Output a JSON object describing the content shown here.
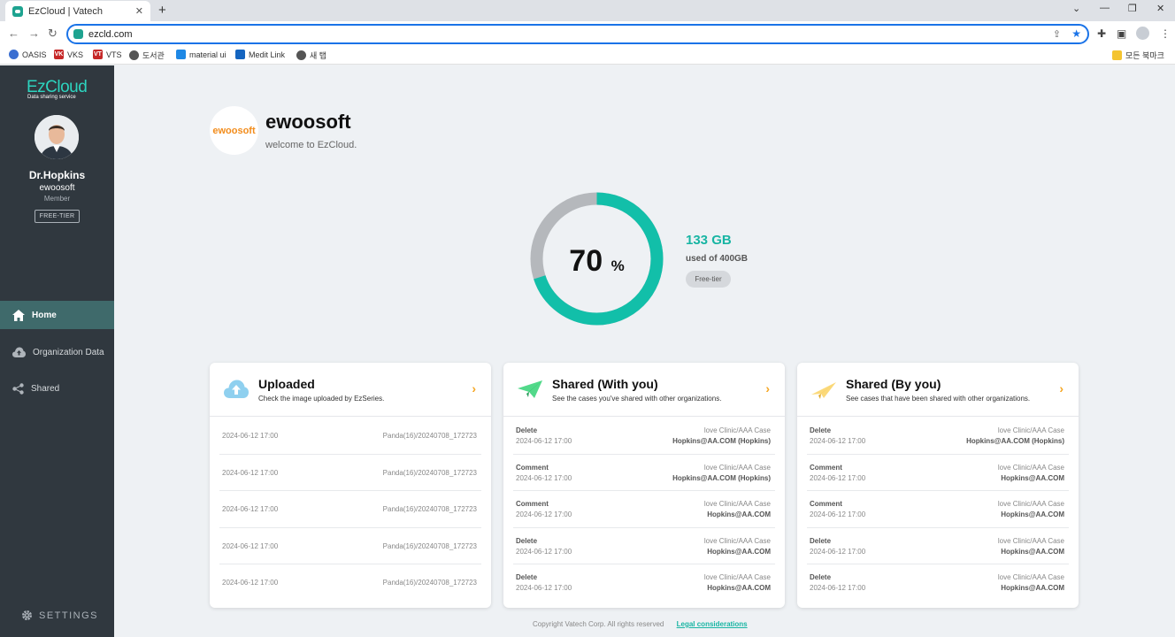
{
  "browser": {
    "tab_title": "EzCloud | Vatech",
    "url": "ezcld.com",
    "bookmarks": [
      {
        "label": "OASIS",
        "color": "#3b6fd1",
        "badge": ""
      },
      {
        "label": "VKS",
        "color": "#c62828",
        "badge": "VK"
      },
      {
        "label": "VTS",
        "color": "#c62828",
        "badge": "VT"
      },
      {
        "label": "도서관",
        "color": "#555555",
        "badge": ""
      },
      {
        "label": "material ui",
        "color": "#1e88e5",
        "badge": ""
      },
      {
        "label": "Medit Link",
        "color": "#1565c0",
        "badge": ""
      },
      {
        "label": "새 탭",
        "color": "#555555",
        "badge": ""
      }
    ],
    "all_bookmarks": "모든 북마크"
  },
  "sidebar": {
    "logo": "EzCloud",
    "logo_sub": "Data sharing service",
    "user_name": "Dr.Hopkins",
    "user_org": "ewoosoft",
    "user_role": "Member",
    "tier": "FREE-TIER",
    "nav": [
      {
        "label": "Home"
      },
      {
        "label": "Organization Data"
      },
      {
        "label": "Shared"
      }
    ],
    "settings": "SETTINGS"
  },
  "org": {
    "logo_text": "ewoosoft",
    "name": "ewoosoft",
    "welcome": "welcome to EzCloud."
  },
  "storage": {
    "percent": 70,
    "percent_label": "70",
    "percent_sym": "%",
    "used": "133 GB",
    "used_of": "used of 400GB",
    "tier_pill": "Free-tier",
    "colors": {
      "used": "#12bfa9",
      "remaining": "#b5b8bc"
    }
  },
  "cards": {
    "uploaded": {
      "title": "Uploaded",
      "subtitle": "Check the image uploaded by EzSeries.",
      "rows": [
        {
          "date": "2024-06-12 17:00",
          "file": "Panda(16)/20240708_172723"
        },
        {
          "date": "2024-06-12 17:00",
          "file": "Panda(16)/20240708_172723"
        },
        {
          "date": "2024-06-12 17:00",
          "file": "Panda(16)/20240708_172723"
        },
        {
          "date": "2024-06-12 17:00",
          "file": "Panda(16)/20240708_172723"
        },
        {
          "date": "2024-06-12 17:00",
          "file": "Panda(16)/20240708_172723"
        }
      ]
    },
    "shared_with": {
      "title": "Shared (With you)",
      "subtitle": "See the cases you've shared with other organizations.",
      "rows": [
        {
          "action": "Delete",
          "date": "2024-06-12 17:00",
          "case": "love Clinic/AAA Case",
          "who": "Hopkins@AA.COM (Hopkins)"
        },
        {
          "action": "Comment",
          "date": "2024-06-12 17:00",
          "case": "love Clinic/AAA Case",
          "who": "Hopkins@AA.COM (Hopkins)"
        },
        {
          "action": "Comment",
          "date": "2024-06-12 17:00",
          "case": "love Clinic/AAA Case",
          "who": "Hopkins@AA.COM"
        },
        {
          "action": "Delete",
          "date": "2024-06-12 17:00",
          "case": "love Clinic/AAA Case",
          "who": "Hopkins@AA.COM"
        },
        {
          "action": "Delete",
          "date": "2024-06-12 17:00",
          "case": "love Clinic/AAA Case",
          "who": "Hopkins@AA.COM"
        }
      ]
    },
    "shared_by": {
      "title": "Shared (By you)",
      "subtitle": "See cases that have been shared with other organizations.",
      "rows": [
        {
          "action": "Delete",
          "date": "2024-06-12 17:00",
          "case": "love Clinic/AAA Case",
          "who": "Hopkins@AA.COM (Hopkins)"
        },
        {
          "action": "Comment",
          "date": "2024-06-12 17:00",
          "case": "love Clinic/AAA Case",
          "who": "Hopkins@AA.COM"
        },
        {
          "action": "Comment",
          "date": "2024-06-12 17:00",
          "case": "love Clinic/AAA Case",
          "who": "Hopkins@AA.COM"
        },
        {
          "action": "Delete",
          "date": "2024-06-12 17:00",
          "case": "love Clinic/AAA Case",
          "who": "Hopkins@AA.COM"
        },
        {
          "action": "Delete",
          "date": "2024-06-12 17:00",
          "case": "love Clinic/AAA Case",
          "who": "Hopkins@AA.COM"
        }
      ]
    }
  },
  "footer": {
    "copyright": "Copyright Vatech Corp. All rights reserved",
    "legal": "Legal considerations"
  }
}
